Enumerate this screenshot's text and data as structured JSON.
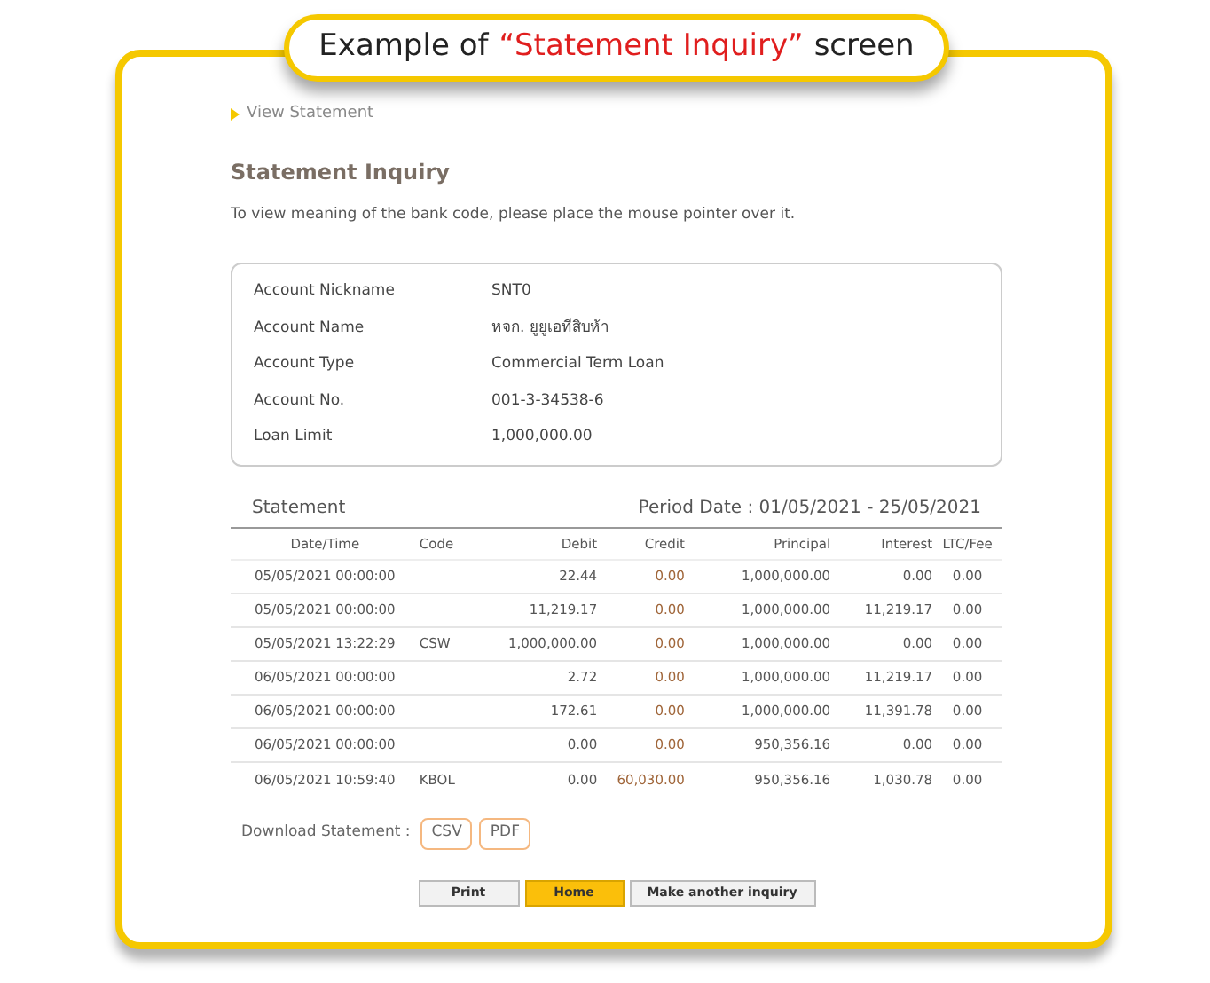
{
  "banner": {
    "prefix": "Example of",
    "highlight": "“Statement Inquiry”",
    "suffix": "screen"
  },
  "breadcrumb": "View Statement",
  "heading": "Statement Inquiry",
  "instruction": "To view meaning of the bank code, please place the mouse pointer over it.",
  "account": [
    {
      "label": "Account Nickname",
      "value": "SNT0"
    },
    {
      "label": "Account Name",
      "value": "หจก. ยูยูเอทีสิบห้า"
    },
    {
      "label": "Account Type",
      "value": "Commercial Term Loan"
    },
    {
      "label": "Account No.",
      "value": "001-3-34538-6"
    },
    {
      "label": "Loan Limit",
      "value": "1,000,000.00"
    }
  ],
  "statement": {
    "title": "Statement",
    "period": "Period Date : 01/05/2021 - 25/05/2021",
    "columns": [
      "Date/Time",
      "Code",
      "Debit",
      "Credit",
      "Principal",
      "Interest",
      "LTC/Fee"
    ],
    "rows": [
      [
        "05/05/2021 00:00:00",
        "",
        "22.44",
        "0.00",
        "1,000,000.00",
        "0.00",
        "0.00"
      ],
      [
        "05/05/2021 00:00:00",
        "",
        "11,219.17",
        "0.00",
        "1,000,000.00",
        "11,219.17",
        "0.00"
      ],
      [
        "05/05/2021 13:22:29",
        "CSW",
        "1,000,000.00",
        "0.00",
        "1,000,000.00",
        "0.00",
        "0.00"
      ],
      [
        "06/05/2021 00:00:00",
        "",
        "2.72",
        "0.00",
        "1,000,000.00",
        "11,219.17",
        "0.00"
      ],
      [
        "06/05/2021 00:00:00",
        "",
        "172.61",
        "0.00",
        "1,000,000.00",
        "11,391.78",
        "0.00"
      ],
      [
        "06/05/2021 00:00:00",
        "",
        "0.00",
        "0.00",
        "950,356.16",
        "0.00",
        "0.00"
      ],
      [
        "06/05/2021 10:59:40",
        "KBOL",
        "0.00",
        "60,030.00",
        "950,356.16",
        "1,030.78",
        "0.00"
      ]
    ]
  },
  "download": {
    "label": "Download Statement :",
    "formats": [
      "CSV",
      "PDF"
    ]
  },
  "buttons": [
    {
      "label": "Print",
      "primary": false
    },
    {
      "label": "Home",
      "primary": true
    },
    {
      "label": "Make another inquiry",
      "primary": false
    }
  ]
}
